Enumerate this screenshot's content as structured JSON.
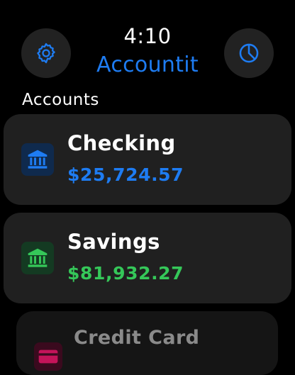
{
  "colors": {
    "accent_blue": "#1E7CF2",
    "accent_green": "#35C759",
    "credit_pink": "#C4145A",
    "dimmed_text": "#8A8A8A"
  },
  "header": {
    "time": "4:10",
    "app_title": "Accountit",
    "left_button_icon": "gear-icon",
    "right_button_icon": "pie-chart-icon"
  },
  "accounts": {
    "section_label": "Accounts",
    "items": [
      {
        "name": "Checking",
        "balance": "$25,724.57",
        "icon": "bank-icon",
        "color": "#1E7CF2"
      },
      {
        "name": "Savings",
        "balance": "$81,932.27",
        "icon": "bank-icon",
        "color": "#35C759"
      },
      {
        "name": "Credit Card",
        "balance": "",
        "icon": "credit-card-icon",
        "color": "#C4145A"
      }
    ]
  }
}
